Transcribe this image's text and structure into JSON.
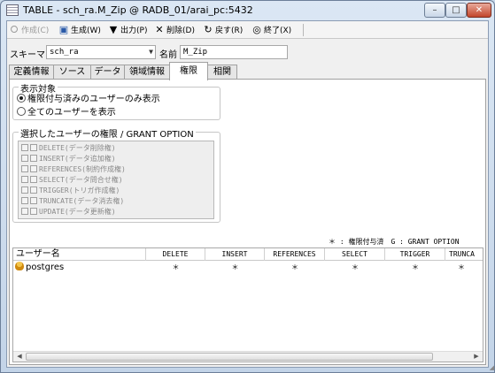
{
  "window": {
    "title": "TABLE - sch_ra.M_Zip @ RADB_01/arai_pc:5432",
    "controls": {
      "minimize": "–",
      "maximize": "□",
      "close": "✕"
    }
  },
  "toolbar": {
    "create": "作成(C)",
    "generate": "生成(W)",
    "output": "出力(P)",
    "delete": "削除(D)",
    "back": "戻す(R)",
    "exit": "終了(X)",
    "icons": {
      "create": "⭘",
      "generate": "▣",
      "output": "▼",
      "delete": "✕",
      "back": "↻",
      "exit": "◎"
    }
  },
  "schema": {
    "label": "スキーマ",
    "value": "sch_ra"
  },
  "name": {
    "label": "名前",
    "value": "M_Zip"
  },
  "tabs": [
    {
      "label": "定義情報"
    },
    {
      "label": "ソース"
    },
    {
      "label": "データ"
    },
    {
      "label": "領域情報"
    },
    {
      "label": "権限",
      "active": true
    },
    {
      "label": "相関"
    }
  ],
  "display_target": {
    "title": "表示対象",
    "option_granted": "権限付与済みのユーザーのみ表示",
    "option_all": "全てのユーザーを表示",
    "selected": "option_granted"
  },
  "user_perms": {
    "title": "選択したユーザーの権限 / GRANT OPTION",
    "items": [
      "DELETE(データ削除権)",
      "INSERT(データ追加権)",
      "REFERENCES(制約作成権)",
      "SELECT(データ問合せ権)",
      "TRIGGER(トリガ作成権)",
      "TRUNCATE(データ消去権)",
      "UPDATE(データ更新権)"
    ]
  },
  "legend": "＊ : 権限付与済　G : GRANT OPTION",
  "grid": {
    "columns": [
      "ユーザー名",
      "DELETE",
      "INSERT",
      "REFERENCES",
      "SELECT",
      "TRIGGER",
      "TRUNCA"
    ],
    "rows": [
      {
        "user": "postgres",
        "delete": "＊",
        "insert": "＊",
        "references": "＊",
        "select": "＊",
        "trigger": "＊",
        "truncate": "＊"
      }
    ],
    "scroll_left": "◀",
    "scroll_right": "▶"
  }
}
